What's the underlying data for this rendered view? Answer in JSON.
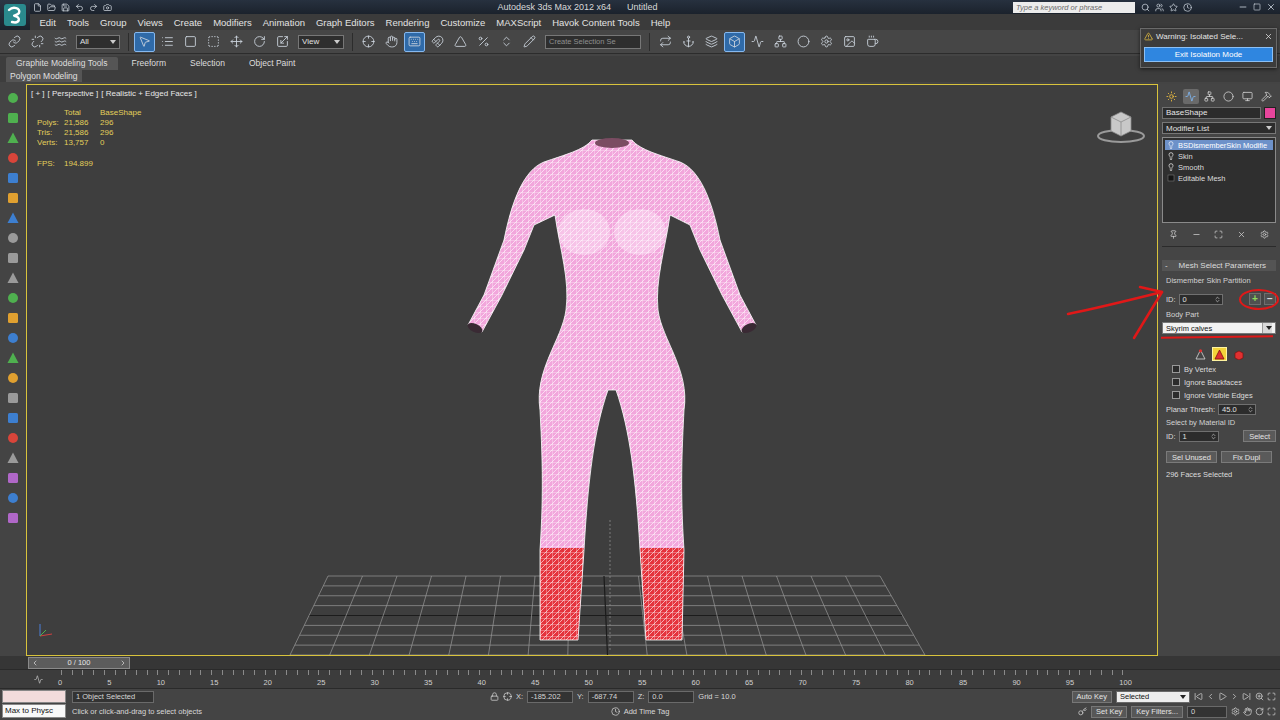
{
  "window": {
    "title": "Autodesk 3ds Max 2012 x64",
    "document": "Untitled"
  },
  "search": {
    "placeholder": "Type a keyword or phrase"
  },
  "menu": [
    "Edit",
    "Tools",
    "Group",
    "Views",
    "Create",
    "Modifiers",
    "Animation",
    "Graph Editors",
    "Rendering",
    "Customize",
    "MAXScript",
    "Havok Content Tools",
    "Help"
  ],
  "toolbar": {
    "selection_filter": "All",
    "reference_coord": "View",
    "named_selection": "Create Selection Se",
    "buttons": [
      {
        "selected": false
      },
      {
        "selected": false
      },
      {
        "selected": false
      },
      {
        "selected": true
      },
      {
        "selected": false
      },
      {
        "selected": false
      },
      {
        "selected": false
      },
      {
        "selected": false
      },
      {
        "selected": false
      },
      {
        "selected": false
      },
      {
        "selected": false
      },
      {
        "selected": false
      },
      {
        "selected": true
      },
      {
        "selected": false
      },
      {
        "selected": false
      },
      {
        "selected": false
      },
      {
        "selected": false
      },
      {
        "selected": false
      },
      {
        "selected": false
      },
      {
        "selected": false
      },
      {
        "selected": false
      },
      {
        "selected": true
      },
      {
        "selected": false
      },
      {
        "selected": false
      },
      {
        "selected": false
      },
      {
        "selected": false
      },
      {
        "selected": false
      },
      {
        "selected": false
      }
    ]
  },
  "ribbon": {
    "tabs": [
      {
        "label": "Graphite Modeling Tools",
        "selected": true
      },
      {
        "label": "Freeform",
        "selected": false
      },
      {
        "label": "Selection",
        "selected": false
      },
      {
        "label": "Object Paint",
        "selected": false
      }
    ],
    "panel": "Polygon Modeling"
  },
  "viewport": {
    "labels": [
      "[ + ]",
      "[ Perspective ]",
      "[ Realistic + Edged Faces ]"
    ],
    "active": true,
    "stats": {
      "columns": [
        "Total",
        "BaseShape"
      ],
      "rows": [
        {
          "label": "Polys:",
          "values": [
            "21,586",
            "296"
          ]
        },
        {
          "label": "Tris:",
          "values": [
            "21,586",
            "296"
          ]
        },
        {
          "label": "Verts:",
          "values": [
            "13,757",
            "0"
          ]
        }
      ]
    },
    "fps": {
      "label": "FPS:",
      "value": "194.899"
    },
    "mesh": {
      "calves_selected": true
    }
  },
  "command_panel": {
    "tabs": [
      {
        "selected": false
      },
      {
        "selected": true
      },
      {
        "selected": false
      },
      {
        "selected": false
      },
      {
        "selected": false
      },
      {
        "selected": false
      }
    ],
    "object_name": "BaseShape",
    "object_color": "#e8459c",
    "modifier_list": "Modifier List",
    "stack": [
      {
        "label": "BSDismemberSkin Modifie",
        "kind": "modifier",
        "selected": true
      },
      {
        "label": "Skin",
        "kind": "modifier",
        "selected": false
      },
      {
        "label": "Smooth",
        "kind": "modifier",
        "selected": false
      },
      {
        "label": "Editable Mesh",
        "kind": "base",
        "selected": false
      }
    ],
    "rollout": {
      "toggle": "-",
      "title": "Mesh Select Parameters"
    },
    "partition": {
      "label": "Dismember Skin Partition",
      "id_label": "ID:",
      "id_value": "0",
      "buttons": [
        "+",
        "−"
      ]
    },
    "body_part": {
      "label": "Body Part",
      "value": "Skyrim calves"
    },
    "sub_object_modes": [
      {
        "selected": false
      },
      {
        "selected": true
      },
      {
        "selected": false
      }
    ],
    "options": [
      {
        "label": "By Vertex",
        "checked": false
      },
      {
        "label": "Ignore Backfaces",
        "checked": false
      },
      {
        "label": "Ignore Visible Edges",
        "checked": false
      }
    ],
    "planar_thresh": {
      "label": "Planar Thresh:",
      "value": "45.0"
    },
    "material_id": {
      "label": "Select by Material ID",
      "id_label": "ID:",
      "id_value": "1",
      "button": "Select"
    },
    "buttons": [
      "Sel Unused",
      "Fix Dupl"
    ],
    "selection_info": "296 Faces Selected"
  },
  "dialog": {
    "title": "Warning: Isolated Sele...",
    "button": "Exit Isolation Mode"
  },
  "timeline": {
    "slider": "0 / 100",
    "ticks": [
      "0",
      "5",
      "10",
      "15",
      "20",
      "25",
      "30",
      "35",
      "40",
      "45",
      "50",
      "55",
      "60",
      "65",
      "70",
      "75",
      "80",
      "85",
      "90",
      "95",
      "100"
    ]
  },
  "status_bar": {
    "maxscript": "Max to Physc",
    "selection": "1 Object Selected",
    "prompt": "Click or click-and-drag to select objects",
    "coords": [
      {
        "label": "X:",
        "value": "-185.202"
      },
      {
        "label": "Y:",
        "value": "-687.74"
      },
      {
        "label": "Z:",
        "value": "0.0"
      }
    ],
    "grid": "Grid = 10.0",
    "time_tag": "Add Time Tag",
    "auto_key": {
      "label": "Auto Key",
      "on": false
    },
    "key_mode": "Selected",
    "set_key": "Set Key",
    "key_filters": "Key Filters...",
    "frame": "0"
  }
}
